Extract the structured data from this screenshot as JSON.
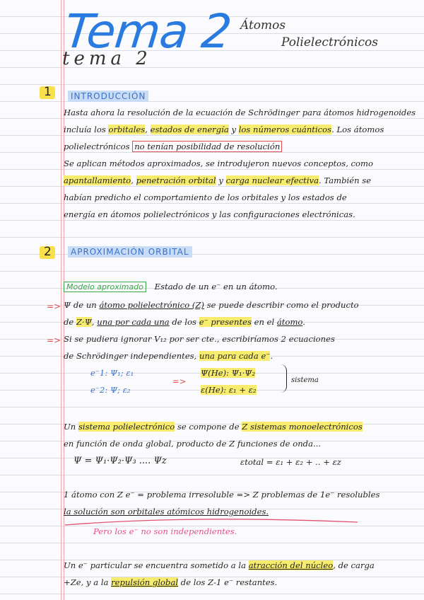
{
  "header": {
    "title": "Tema 2",
    "title_under": "tema 2",
    "topic_line1": "Átomos",
    "topic_line2": "Polielectrónicos"
  },
  "section1": {
    "number": "1",
    "heading": "Introducción",
    "lines": [
      {
        "parts": [
          {
            "t": "Hasta ahora la resolución de la ecuación de Schrödinger para átomos hidrogenoides"
          }
        ]
      },
      {
        "parts": [
          {
            "t": "incluía los "
          },
          {
            "t": "orbitales",
            "hl": true
          },
          {
            "t": ", "
          },
          {
            "t": "estados de energía",
            "hl": true
          },
          {
            "t": " y "
          },
          {
            "t": "los números cuánticos",
            "hl": true
          },
          {
            "t": ". Los átomos"
          }
        ]
      },
      {
        "parts": [
          {
            "t": "polielectrónicos "
          },
          {
            "t": "no tenían posibilidad de resolución",
            "box": true
          }
        ]
      },
      {
        "parts": [
          {
            "t": "Se aplican métodos aproximados, se introdujeron nuevos conceptos, como"
          }
        ]
      },
      {
        "parts": [
          {
            "t": "apantallamiento",
            "hl": true
          },
          {
            "t": ", "
          },
          {
            "t": "penetración orbital",
            "hl": true
          },
          {
            "t": " y "
          },
          {
            "t": "carga nuclear efectiva",
            "hl": true
          },
          {
            "t": ". También se"
          }
        ]
      },
      {
        "parts": [
          {
            "t": "habían predicho el comportamiento de los orbitales y los estados de"
          }
        ]
      },
      {
        "parts": [
          {
            "t": "energía en átomos polielectrónicos y las configuraciones electrónicas."
          }
        ]
      }
    ]
  },
  "section2": {
    "number": "2",
    "heading": "Aproximación orbital",
    "model_label": "Modelo aproximado",
    "model_text": "Estado de un e⁻ en un átomo.",
    "arrow1": "=>",
    "arrow2": "=>",
    "lines": [
      {
        "parts": [
          {
            "t": "Ψ de un "
          },
          {
            "t": "átomo polielectrónico (Z)",
            "under": true
          },
          {
            "t": " se puede describir como el producto"
          }
        ]
      },
      {
        "parts": [
          {
            "t": "de "
          },
          {
            "t": "Z·Ψ",
            "hl": true
          },
          {
            "t": ", "
          },
          {
            "t": "una por cada una",
            "under": true
          },
          {
            "t": " de los "
          },
          {
            "t": "e⁻ presentes",
            "hl": true
          },
          {
            "t": " en el "
          },
          {
            "t": "átomo",
            "under": true
          },
          {
            "t": "."
          }
        ]
      },
      {
        "parts": [
          {
            "t": "Si se pudiera ignorar V₁₂ por ser cte., escribiríamos 2 ecuaciones"
          }
        ]
      },
      {
        "parts": [
          {
            "t": "de Schrödinger independientes, "
          },
          {
            "t": "una para cada e⁻",
            "hl": true
          },
          {
            "t": "."
          }
        ]
      }
    ],
    "e1": "e⁻1: Ψ₁; ε₁",
    "e2": "e⁻2: Ψ; ε₂",
    "implies": "=>",
    "psi_he": "Ψ(He): Ψ₁·Ψ₂",
    "e_he": "ε(He): ε₁ + ε₂",
    "sistema": "sistema",
    "system_lines": [
      {
        "parts": [
          {
            "t": "Un "
          },
          {
            "t": "sistema polielectrónico",
            "hl": true
          },
          {
            "t": " se compone de "
          },
          {
            "t": "Z sistemas monoelectrónicos",
            "hl": true
          }
        ]
      },
      {
        "parts": [
          {
            "t": "en función de onda global, producto de Z funciones de onda..."
          }
        ]
      }
    ],
    "psi_product": "Ψ = Ψ₁·Ψ₂·Ψ₃ .... Ψz",
    "e_total": "εtotal = ε₁ + ε₂ + .. + εz",
    "problem_lines": [
      {
        "parts": [
          {
            "t": "1 átomo con Z e⁻ = problema irresoluble => Z problemas de 1e⁻ resolubles"
          }
        ]
      },
      {
        "parts": [
          {
            "t": "la solución son orbitales atómicos hidrogenoides.",
            "under": true
          }
        ]
      }
    ],
    "note_pink": "Pero los e⁻ no son independientes.",
    "final_lines": [
      {
        "parts": [
          {
            "t": "Un e⁻ particular se encuentra sometido a la "
          },
          {
            "t": "atracción del núcleo",
            "hl": true,
            "under": true
          },
          {
            "t": ", de carga"
          }
        ]
      },
      {
        "parts": [
          {
            "t": "+Ze, y a la "
          },
          {
            "t": "repulsión global",
            "hl": true,
            "under": true
          },
          {
            "t": " de los Z-1 e⁻ restantes."
          }
        ]
      }
    ]
  }
}
